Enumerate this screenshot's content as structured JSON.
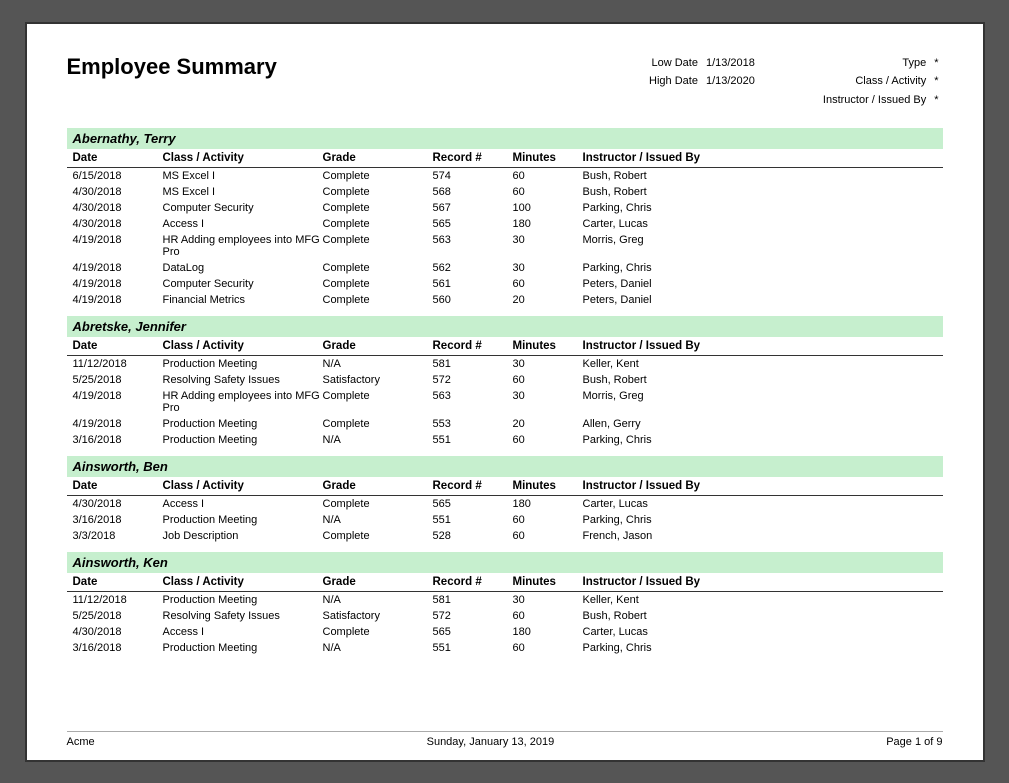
{
  "report": {
    "title": "Employee Summary",
    "meta": {
      "low_date_label": "Low Date",
      "low_date_value": "1/13/2018",
      "high_date_label": "High Date",
      "high_date_value": "1/13/2020",
      "type_label": "Type",
      "type_value": "*",
      "class_label": "Class / Activity",
      "class_value": "*",
      "instructor_label": "Instructor / Issued By",
      "instructor_value": "*"
    }
  },
  "col_headers": {
    "date": "Date",
    "activity": "Class / Activity",
    "grade": "Grade",
    "record": "Record #",
    "minutes": "Minutes",
    "instructor": "Instructor / Issued By"
  },
  "employees": [
    {
      "name": "Abernathy, Terry",
      "rows": [
        {
          "date": "6/15/2018",
          "activity": "MS Excel I",
          "grade": "Complete",
          "record": "574",
          "minutes": "60",
          "instructor": "Bush, Robert"
        },
        {
          "date": "4/30/2018",
          "activity": "MS Excel I",
          "grade": "Complete",
          "record": "568",
          "minutes": "60",
          "instructor": "Bush, Robert"
        },
        {
          "date": "4/30/2018",
          "activity": "Computer Security",
          "grade": "Complete",
          "record": "567",
          "minutes": "100",
          "instructor": "Parking, Chris"
        },
        {
          "date": "4/30/2018",
          "activity": "Access I",
          "grade": "Complete",
          "record": "565",
          "minutes": "180",
          "instructor": "Carter, Lucas"
        },
        {
          "date": "4/19/2018",
          "activity": "HR Adding employees into MFG Pro",
          "grade": "Complete",
          "record": "563",
          "minutes": "30",
          "instructor": "Morris, Greg"
        },
        {
          "date": "4/19/2018",
          "activity": "DataLog",
          "grade": "Complete",
          "record": "562",
          "minutes": "30",
          "instructor": "Parking, Chris"
        },
        {
          "date": "4/19/2018",
          "activity": "Computer Security",
          "grade": "Complete",
          "record": "561",
          "minutes": "60",
          "instructor": "Peters, Daniel"
        },
        {
          "date": "4/19/2018",
          "activity": "Financial Metrics",
          "grade": "Complete",
          "record": "560",
          "minutes": "20",
          "instructor": "Peters, Daniel"
        }
      ]
    },
    {
      "name": "Abretske, Jennifer",
      "rows": [
        {
          "date": "11/12/2018",
          "activity": "Production Meeting",
          "grade": "N/A",
          "record": "581",
          "minutes": "30",
          "instructor": "Keller, Kent"
        },
        {
          "date": "5/25/2018",
          "activity": "Resolving Safety Issues",
          "grade": "Satisfactory",
          "record": "572",
          "minutes": "60",
          "instructor": "Bush, Robert"
        },
        {
          "date": "4/19/2018",
          "activity": "HR Adding employees into MFG Pro",
          "grade": "Complete",
          "record": "563",
          "minutes": "30",
          "instructor": "Morris, Greg"
        },
        {
          "date": "4/19/2018",
          "activity": "Production Meeting",
          "grade": "Complete",
          "record": "553",
          "minutes": "20",
          "instructor": "Allen, Gerry"
        },
        {
          "date": "3/16/2018",
          "activity": "Production Meeting",
          "grade": "N/A",
          "record": "551",
          "minutes": "60",
          "instructor": "Parking, Chris"
        }
      ]
    },
    {
      "name": "Ainsworth, Ben",
      "rows": [
        {
          "date": "4/30/2018",
          "activity": "Access I",
          "grade": "Complete",
          "record": "565",
          "minutes": "180",
          "instructor": "Carter, Lucas"
        },
        {
          "date": "3/16/2018",
          "activity": "Production Meeting",
          "grade": "N/A",
          "record": "551",
          "minutes": "60",
          "instructor": "Parking, Chris"
        },
        {
          "date": "3/3/2018",
          "activity": "Job Description",
          "grade": "Complete",
          "record": "528",
          "minutes": "60",
          "instructor": "French, Jason"
        }
      ]
    },
    {
      "name": "Ainsworth, Ken",
      "rows": [
        {
          "date": "11/12/2018",
          "activity": "Production Meeting",
          "grade": "N/A",
          "record": "581",
          "minutes": "30",
          "instructor": "Keller, Kent"
        },
        {
          "date": "5/25/2018",
          "activity": "Resolving Safety Issues",
          "grade": "Satisfactory",
          "record": "572",
          "minutes": "60",
          "instructor": "Bush, Robert"
        },
        {
          "date": "4/30/2018",
          "activity": "Access I",
          "grade": "Complete",
          "record": "565",
          "minutes": "180",
          "instructor": "Carter, Lucas"
        },
        {
          "date": "3/16/2018",
          "activity": "Production Meeting",
          "grade": "N/A",
          "record": "551",
          "minutes": "60",
          "instructor": "Parking, Chris"
        }
      ]
    }
  ],
  "footer": {
    "company": "Acme",
    "date": "Sunday, January 13, 2019",
    "page": "Page 1 of 9"
  }
}
